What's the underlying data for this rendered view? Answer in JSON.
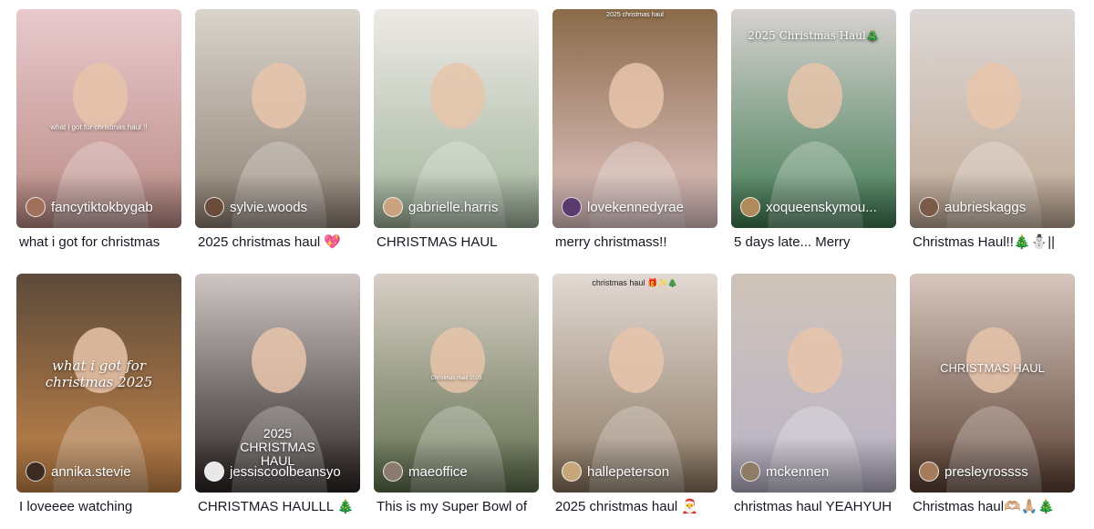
{
  "videos": [
    {
      "username": "fancytiktokbygab",
      "caption": "what i got for christmas",
      "overlay": "what i got for christmas haul !!",
      "bg": [
        "#e9c9cc",
        "#b88a84"
      ],
      "avatar": "#a0705a"
    },
    {
      "username": "sylvie.woods",
      "caption": "2025 christmas haul 💖",
      "overlay": "",
      "bg": [
        "#d9d4cc",
        "#8d7f72"
      ],
      "avatar": "#6b4b3a"
    },
    {
      "username": "gabrielle.harris",
      "caption": "CHRISTMAS HAUL",
      "overlay": "",
      "bg": [
        "#eeeae6",
        "#9fb39a"
      ],
      "avatar": "#c9a27f"
    },
    {
      "username": "lovekennedyrae",
      "caption": "merry christmass!!",
      "overlay": "2025 christmas haul",
      "bg": [
        "#8a6b4a",
        "#e6c9c9"
      ],
      "avatar": "#5b3a6e"
    },
    {
      "username": "xoqueenskymou...",
      "caption": "5 days late... Merry",
      "overlay": "2025 Christmas Haul🎄",
      "bg": [
        "#d7d2d0",
        "#3f7a52"
      ],
      "avatar": "#b08a5b"
    },
    {
      "username": "aubrieskaggs",
      "caption": "Christmas Haul!!🎄⛄||",
      "overlay": "",
      "bg": [
        "#ddd7d5",
        "#bfa995"
      ],
      "avatar": "#7c5a48"
    },
    {
      "username": "annika.stevie",
      "caption": "I loveeee watching",
      "overlay": "what i got for christmas 2025",
      "bg": [
        "#5c4a3a",
        "#c9874a"
      ],
      "avatar": "#3b2b22"
    },
    {
      "username": "jessiscoolbeansyo",
      "caption": "CHRISTMAS HAULLL 🎄",
      "overlay": "2025 CHRISTMAS HAUL",
      "bg": [
        "#cfc6c4",
        "#2b2422"
      ],
      "avatar": "#e8e8e8"
    },
    {
      "username": "maeoffice",
      "caption": "This is my Super Bowl of",
      "overlay": "Christmas Haul 2025",
      "bg": [
        "#d8cfc6",
        "#5e6e4c"
      ],
      "avatar": "#8a7b6e"
    },
    {
      "username": "hallepeterson",
      "caption": "2025 christmas haul 🎅",
      "overlay": "christmas haul 🎁✨🎄",
      "bg": [
        "#e2d9d3",
        "#8a7660"
      ],
      "avatar": "#c7a77a"
    },
    {
      "username": "mckennen",
      "caption": "christmas haul YEAHYUH",
      "overlay": "",
      "bg": [
        "#cfc3b8",
        "#b9b3c8"
      ],
      "avatar": "#8e7c66"
    },
    {
      "username": "presleyrossss",
      "caption": "Christmas haul🫶🏼🙏🏼🎄",
      "overlay": "CHRISTMAS HAUL",
      "bg": [
        "#d6c6bd",
        "#5b4033"
      ],
      "avatar": "#a67b5b"
    }
  ]
}
